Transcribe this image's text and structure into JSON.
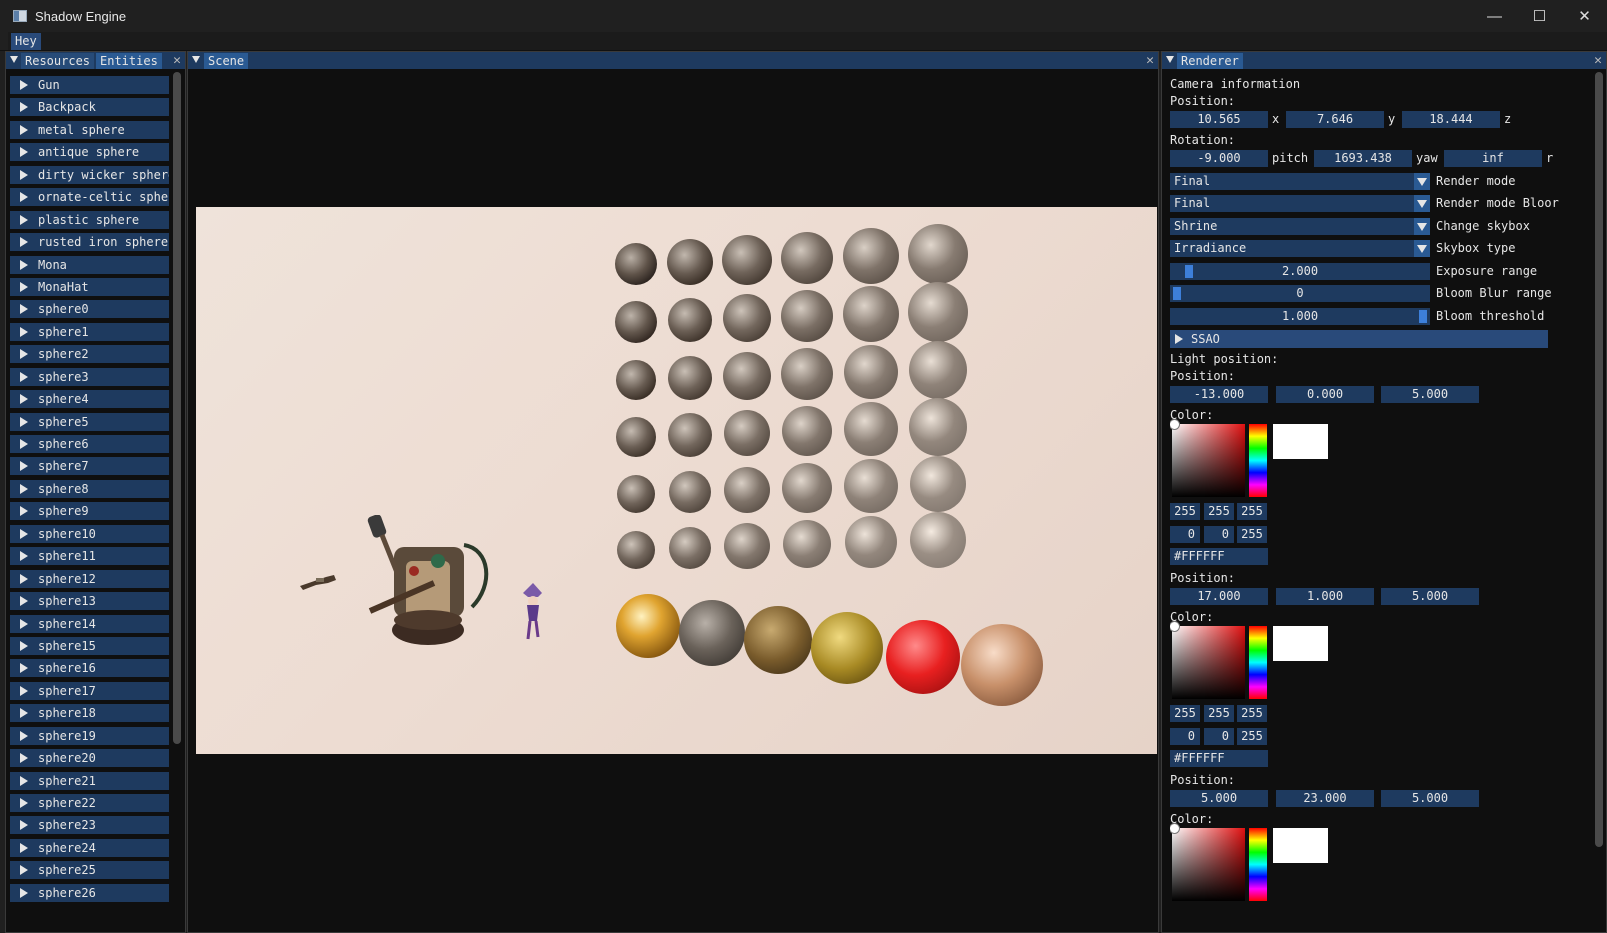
{
  "window": {
    "title": "Shadow Engine",
    "minimize": "—",
    "maximize": "☐",
    "close": "✕"
  },
  "menubar": {
    "item": "Hey"
  },
  "left_panel": {
    "tabs": [
      "Resources",
      "Entities"
    ],
    "close": "✕",
    "items": [
      "Gun",
      "Backpack",
      "metal sphere",
      "antique sphere",
      "dirty wicker sphere",
      "ornate-celtic spher",
      "plastic sphere",
      "rusted iron sphere",
      "Mona",
      "MonaHat",
      "sphere0",
      "sphere1",
      "sphere2",
      "sphere3",
      "sphere4",
      "sphere5",
      "sphere6",
      "sphere7",
      "sphere8",
      "sphere9",
      "sphere10",
      "sphere11",
      "sphere12",
      "sphere13",
      "sphere14",
      "sphere15",
      "sphere16",
      "sphere17",
      "sphere18",
      "sphere19",
      "sphere20",
      "sphere21",
      "sphere22",
      "sphere23",
      "sphere24",
      "sphere25",
      "sphere26"
    ]
  },
  "scene_panel": {
    "tab": "Scene",
    "close": "✕"
  },
  "renderer": {
    "tab": "Renderer",
    "close": "✕",
    "camera_title": "Camera information",
    "position_label": "Position:",
    "position": {
      "x": "10.565",
      "y": "7.646",
      "z": "18.444",
      "x_lbl": "x",
      "y_lbl": "y",
      "z_lbl": "z"
    },
    "rotation_label": "Rotation:",
    "rotation": {
      "pitch": "-9.000",
      "yaw": "1693.438",
      "roll": "inf",
      "pitch_lbl": "pitch",
      "yaw_lbl": "yaw",
      "roll_lbl": "r"
    },
    "render_mode": {
      "value": "Final",
      "label": "Render mode"
    },
    "render_mode_bloom": {
      "value": "Final",
      "label": "Render mode Bloor"
    },
    "skybox": {
      "value": "Shrine",
      "label": "Change skybox"
    },
    "skybox_type": {
      "value": "Irradiance",
      "label": "Skybox type"
    },
    "exposure": {
      "value": "2.000",
      "label": "Exposure range",
      "fraction": 0.05
    },
    "bloom_blur": {
      "value": "0",
      "label": "Bloom Blur range",
      "fraction": 0.0
    },
    "bloom_threshold": {
      "value": "1.000",
      "label": "Bloom threshold",
      "fraction": 1.0
    },
    "ssao": "SSAO",
    "light_title": "Light position:",
    "color_label": "Color:",
    "lights": [
      {
        "pos_label": "Position:",
        "pos": [
          "-13.000",
          "0.000",
          "5.000"
        ],
        "rgb": [
          "255",
          "255",
          "255"
        ],
        "hsv": [
          "0",
          "0",
          "255"
        ],
        "hex": "#FFFFFF"
      },
      {
        "pos_label": "Position:",
        "pos": [
          "17.000",
          "1.000",
          "5.000"
        ],
        "rgb": [
          "255",
          "255",
          "255"
        ],
        "hsv": [
          "0",
          "0",
          "255"
        ],
        "hex": "#FFFFFF"
      },
      {
        "pos_label": "Position:",
        "pos": [
          "5.000",
          "23.000",
          "5.000"
        ]
      }
    ]
  },
  "colors": {
    "accent": "#294a7a",
    "frame": "#1e3a5f",
    "bg": "#0f0f0f",
    "scene_bg": "#ecdfd6"
  }
}
